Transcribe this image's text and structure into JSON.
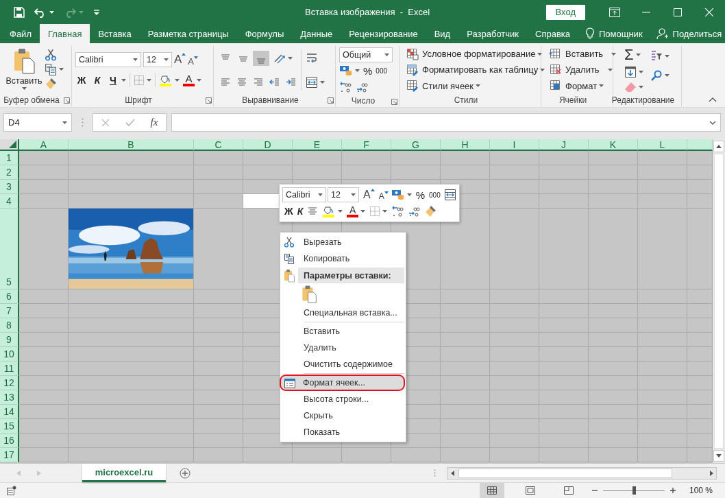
{
  "window": {
    "title": "Вставка изображения  -  Excel",
    "sign_in": "Вход"
  },
  "quick_access": [
    {
      "kind": "save",
      "disabled": false
    },
    {
      "kind": "undo",
      "disabled": false
    },
    {
      "kind": "redo",
      "disabled": true
    },
    {
      "kind": "customize",
      "disabled": false
    }
  ],
  "tabs": [
    {
      "label": "Файл",
      "selected": false
    },
    {
      "label": "Главная",
      "selected": true
    },
    {
      "label": "Вставка",
      "selected": false
    },
    {
      "label": "Разметка страницы",
      "selected": false
    },
    {
      "label": "Формулы",
      "selected": false
    },
    {
      "label": "Данные",
      "selected": false
    },
    {
      "label": "Рецензирование",
      "selected": false
    },
    {
      "label": "Вид",
      "selected": false
    },
    {
      "label": "Разработчик",
      "selected": false
    },
    {
      "label": "Справка",
      "selected": false
    }
  ],
  "assistant": "Помощник",
  "share": "Поделиться",
  "ribbon": {
    "clipboard": {
      "paste": "Вставить",
      "label": "Буфер обмена"
    },
    "font": {
      "name": "Calibri",
      "size": "12",
      "grow": "A",
      "shrink": "A",
      "bold": "Ж",
      "italic": "К",
      "underline": "Ч",
      "font_color": "A",
      "label": "Шрифт"
    },
    "alignment": {
      "vertical": [
        {
          "selected": false
        },
        {
          "selected": false
        },
        {
          "selected": true
        }
      ],
      "label": "Выравнивание"
    },
    "number": {
      "format": "Общий",
      "percent": "%",
      "thousands": "000",
      "label": "Число"
    },
    "styles": {
      "items": [
        "Условное форматирование",
        "Форматировать как таблицу",
        "Стили ячеек"
      ],
      "label": "Стили"
    },
    "cells": {
      "items": [
        "Вставить",
        "Удалить",
        "Формат"
      ],
      "label": "Ячейки"
    },
    "editing": {
      "sum": "Σ",
      "label": "Редактирование"
    }
  },
  "formula_bar": {
    "name_box": "D4",
    "function": "fx"
  },
  "sheet": {
    "columns": [
      {
        "label": "A",
        "active": false
      },
      {
        "label": "B",
        "active": false
      },
      {
        "label": "C",
        "active": false
      },
      {
        "label": "D",
        "active": true
      },
      {
        "label": "E",
        "active": false
      },
      {
        "label": "F",
        "active": false
      },
      {
        "label": "G",
        "active": false
      },
      {
        "label": "H",
        "active": false
      },
      {
        "label": "I",
        "active": false
      },
      {
        "label": "J",
        "active": false
      },
      {
        "label": "K",
        "active": false
      },
      {
        "label": "L",
        "active": false
      }
    ],
    "rows": [
      {
        "label": "1",
        "kind": "normal",
        "active": false
      },
      {
        "label": "2",
        "kind": "normal",
        "active": false
      },
      {
        "label": "3",
        "kind": "normal",
        "active": false
      },
      {
        "label": "4",
        "kind": "normal",
        "active": true
      },
      {
        "label": "5",
        "kind": "tall",
        "active": false
      },
      {
        "label": "6",
        "kind": "normal",
        "active": false
      },
      {
        "label": "7",
        "kind": "normal",
        "active": false
      },
      {
        "label": "8",
        "kind": "normal",
        "active": false
      },
      {
        "label": "9",
        "kind": "normal",
        "active": false
      },
      {
        "label": "10",
        "kind": "normal",
        "active": false
      },
      {
        "label": "11",
        "kind": "normal",
        "active": false
      },
      {
        "label": "12",
        "kind": "normal",
        "active": false
      },
      {
        "label": "13",
        "kind": "normal",
        "active": false
      },
      {
        "label": "14",
        "kind": "normal",
        "active": false
      },
      {
        "label": "15",
        "kind": "normal",
        "active": false
      },
      {
        "label": "16",
        "kind": "normal",
        "active": false
      },
      {
        "label": "17",
        "kind": "normal",
        "active": false
      }
    ]
  },
  "mini_toolbar": {
    "font": "Calibri",
    "size": "12",
    "grow": "A",
    "shrink": "A",
    "percent": "%",
    "thousands": "000",
    "bold": "Ж",
    "italic": "К",
    "font_color": "A"
  },
  "context_menu": [
    {
      "kind": "cut",
      "label": "Вырезать",
      "selected": false
    },
    {
      "kind": "copy",
      "label": "Копировать",
      "selected": false
    },
    {
      "kind": "header",
      "label": "Параметры вставки:"
    },
    {
      "kind": "paste-options"
    },
    {
      "kind": "item",
      "label": "Специальная вставка...",
      "selected": false
    },
    {
      "kind": "separator"
    },
    {
      "kind": "item",
      "label": "Вставить",
      "selected": false
    },
    {
      "kind": "item",
      "label": "Удалить",
      "selected": false
    },
    {
      "kind": "item",
      "label": "Очистить содержимое",
      "selected": false
    },
    {
      "kind": "separator"
    },
    {
      "kind": "format",
      "label": "Формат ячеек...",
      "selected": true
    },
    {
      "kind": "item",
      "label": "Высота строки...",
      "selected": false
    },
    {
      "kind": "item",
      "label": "Скрыть",
      "selected": false
    },
    {
      "kind": "item",
      "label": "Показать",
      "selected": false
    }
  ],
  "sheet_tabs": [
    {
      "label": "microexcel.ru",
      "selected": true
    }
  ],
  "status_bar": {
    "views": [
      {
        "selected": true
      },
      {
        "selected": false
      },
      {
        "selected": false
      }
    ],
    "zoom": {
      "level": 0.5,
      "reading": "100 %"
    }
  }
}
